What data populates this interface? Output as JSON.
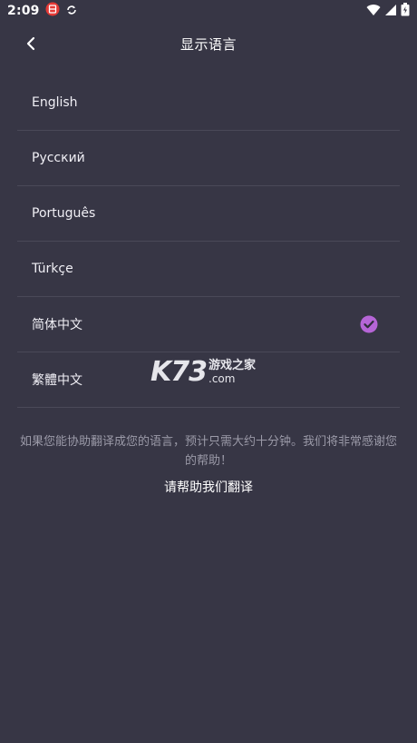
{
  "status_bar": {
    "time": "2:09"
  },
  "app_bar": {
    "title": "显示语言"
  },
  "languages": [
    {
      "label": "English",
      "selected": false
    },
    {
      "label": "Русский",
      "selected": false
    },
    {
      "label": "Português",
      "selected": false
    },
    {
      "label": "Türkçe",
      "selected": false
    },
    {
      "label": "简体中文",
      "selected": true
    },
    {
      "label": "繁體中文",
      "selected": false
    }
  ],
  "help": {
    "description": "如果您能协助翻译成您的语言，预计只需大约十分钟。我们将非常感谢您的帮助！",
    "link_label": "请帮助我们翻译"
  },
  "watermark": {
    "mark": "K73",
    "line1": "游戏之家",
    "line2": ".com"
  },
  "colors": {
    "background": "#373645",
    "accent": "#b565d6",
    "divider": "#4a4958"
  }
}
